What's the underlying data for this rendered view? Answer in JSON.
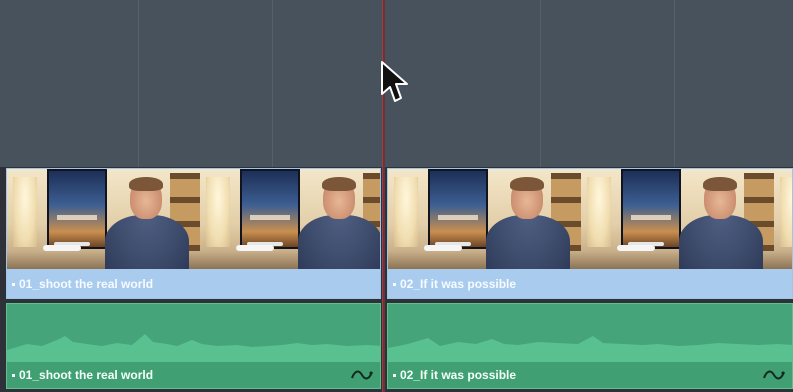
{
  "timeline": {
    "video_clips": [
      {
        "name": "01_shoot the real world",
        "thumbnail_scene": "presenter-in-room"
      },
      {
        "name": "02_If it was possible",
        "thumbnail_scene": "presenter-in-room"
      }
    ],
    "audio_clips": [
      {
        "name": "01_shoot the real world",
        "keyframe_icon": "audio-keyframe-icon"
      },
      {
        "name": "02_If it was possible",
        "keyframe_icon": "audio-keyframe-icon"
      }
    ]
  },
  "colors": {
    "empty_track": "#48525d",
    "video_clip": "#a8cbee",
    "audio_clip": "#45a47a",
    "playhead": "#6e3338"
  },
  "cursor": {
    "icon": "pointer-arrow-icon"
  }
}
